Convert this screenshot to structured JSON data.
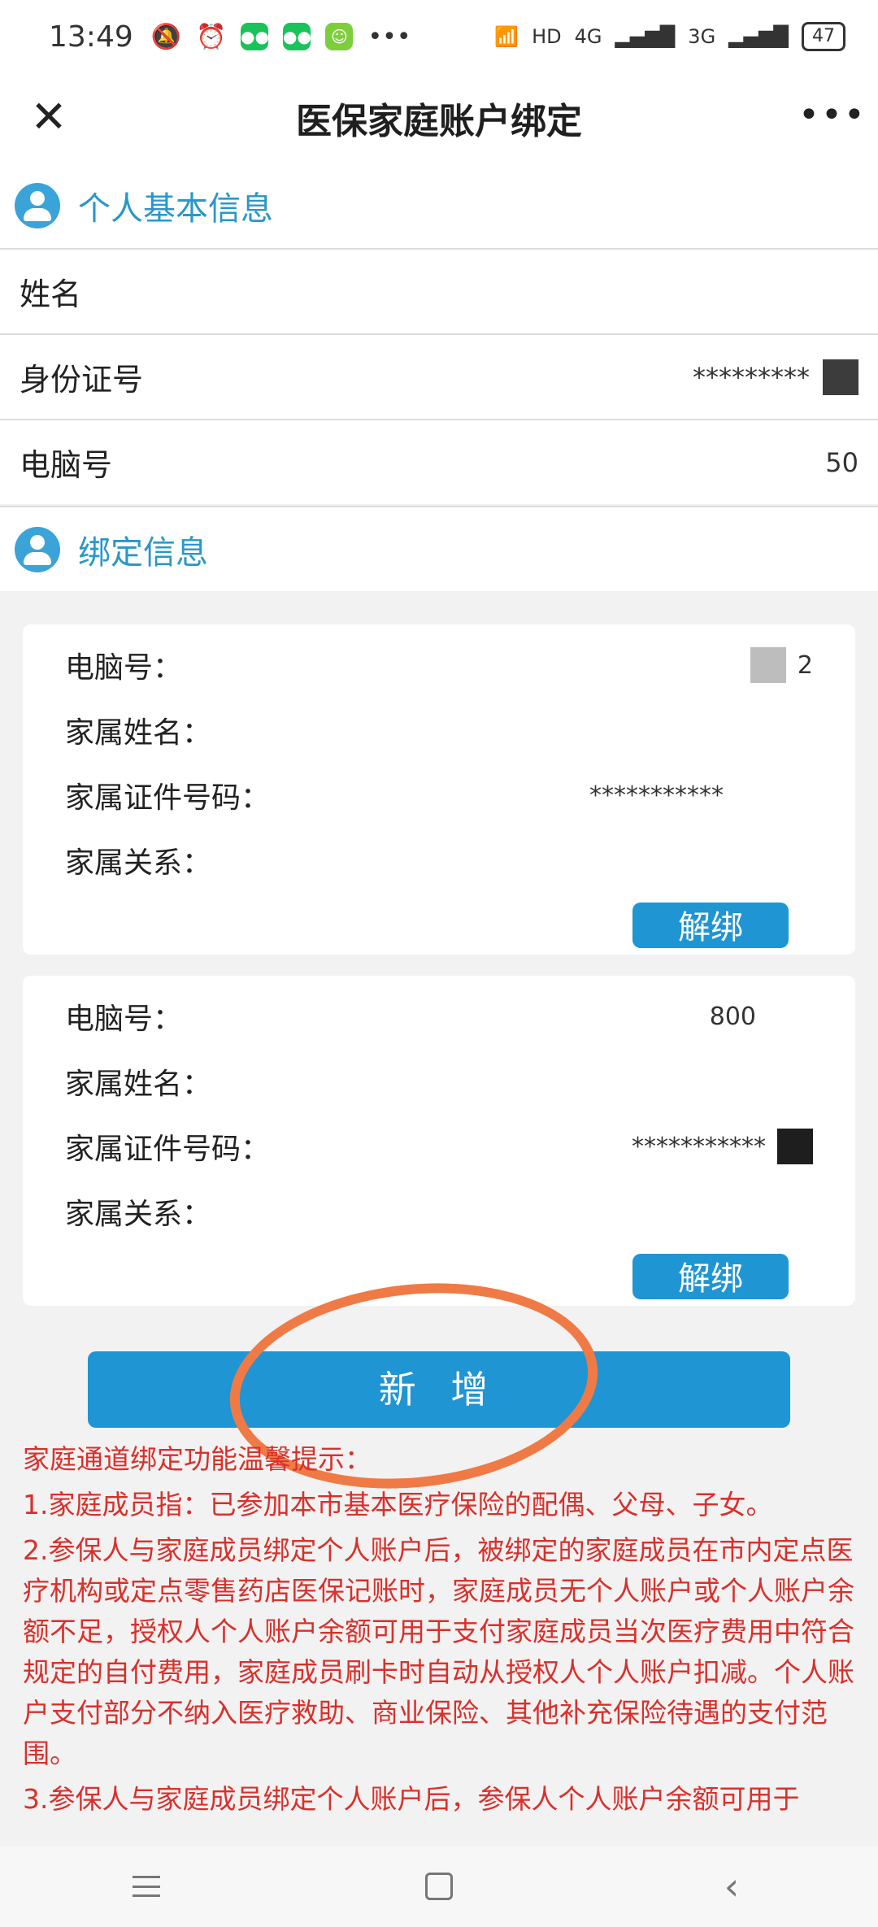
{
  "status_bar": {
    "time": "13:49",
    "icons": [
      "mute-icon",
      "alarm-icon",
      "wechat-icon",
      "wechat-icon",
      "app-icon",
      "more-icon"
    ],
    "network_1": "4G",
    "network_2": "3G",
    "hd_label": "HD",
    "battery": "47"
  },
  "nav": {
    "title": "医保家庭账户绑定",
    "close_icon": "close-icon",
    "more_icon": "more-icon"
  },
  "personal": {
    "section_title": "个人基本信息",
    "rows": [
      {
        "label": "姓名",
        "value": ""
      },
      {
        "label": "身份证号",
        "value": "*********"
      },
      {
        "label": "电脑号",
        "value": "50"
      }
    ]
  },
  "binding": {
    "section_title": "绑定信息",
    "cards": [
      {
        "computer_no_label": "电脑号：",
        "computer_no": "2",
        "name_label": "家属姓名：",
        "name": "",
        "id_label": "家属证件号码：",
        "id": "***********",
        "relation_label": "家属关系：",
        "relation": "",
        "unbind_label": "解绑"
      },
      {
        "computer_no_label": "电脑号：",
        "computer_no": "800",
        "name_label": "家属姓名：",
        "name": "",
        "id_label": "家属证件号码：",
        "id": "***********",
        "relation_label": "家属关系：",
        "relation": "",
        "unbind_label": "解绑"
      }
    ]
  },
  "add_button": "新 增",
  "notice": {
    "title": "家庭通道绑定功能温馨提示：",
    "items": [
      "1.家庭成员指：已参加本市基本医疗保险的配偶、父母、子女。",
      "2.参保人与家庭成员绑定个人账户后，被绑定的家庭成员在市内定点医疗机构或定点零售药店医保记账时，家庭成员无个人账户或个人账户余额不足，授权人个人账户余额可用于支付家庭成员当次医疗费用中符合规定的自付费用，家庭成员刷卡时自动从授权人个人账户扣减。个人账户支付部分不纳入医疗救助、商业保险、其他补充保险待遇的支付范围。",
      "3.参保人与家庭成员绑定个人账户后，参保人个人账户余额可用于"
    ]
  },
  "colors": {
    "accent": "#1f95d3",
    "section_title": "#2a97c9",
    "notice": "#d9302b",
    "annotation": "#f07a45"
  }
}
